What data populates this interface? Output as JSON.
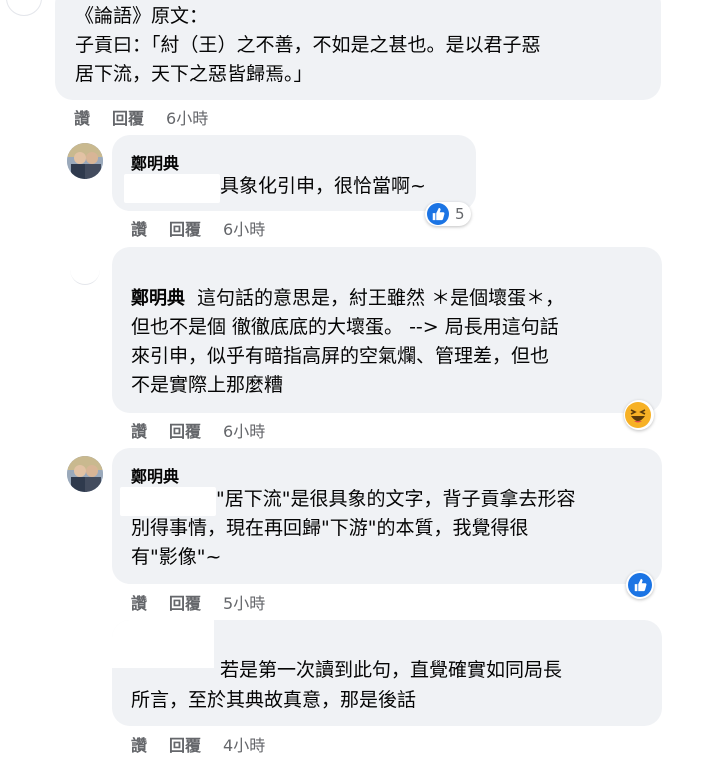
{
  "colors": {
    "bubble_bg": "#f0f2f5",
    "action_text": "#65676b",
    "like_blue": "#1b74e4",
    "haha_yellow": "#f7b125"
  },
  "actions": {
    "like_label": "讚",
    "reply_label": "回覆"
  },
  "comments": [
    {
      "line1": "《論語》原文：",
      "line2": "子貢曰：「紂（王）之不善，不如是之甚也。是以君子惡",
      "line3": "居下流，天下之惡皆歸焉。」",
      "time": "6小時"
    },
    {
      "author": "鄭明典",
      "text": "具象化引申，很恰當啊~",
      "time": "6小時",
      "reaction_icon": "like-icon",
      "reaction_count": "5"
    },
    {
      "author": "鄭明典",
      "line1": "這句話的意思是，紂王雖然 ＊是個壞蛋＊，",
      "line2": "但也不是個 徹徹底底的大壞蛋。 --> 局長用這句話",
      "line3": "來引申，似乎有暗指高屏的空氣爛、管理差，但也",
      "line4": "不是實際上那麼糟",
      "time": "6小時",
      "reaction_icon": "haha-icon"
    },
    {
      "author": "鄭明典",
      "line1": "\"居下流\"是很具象的文字，背子貢拿去形容",
      "line2": "別得事情，現在再回歸\"下游\"的本質，我覺得很",
      "line3": "有\"影像\"~",
      "time": "5小時",
      "reaction_icon": "like-icon"
    },
    {
      "line1": "若是第一次讀到此句，直覺確實如同局長",
      "line2": "所言，至於其典故真意，那是後話",
      "time": "4小時"
    }
  ]
}
